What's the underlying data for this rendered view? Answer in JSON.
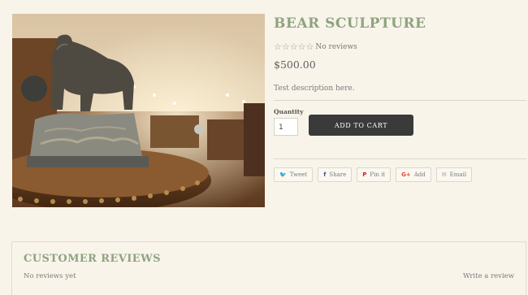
{
  "product": {
    "title": "BEAR SCULPTURE",
    "rating_stars": 5,
    "rating_text": "No reviews",
    "price": "$500.00",
    "description": "Test description here.",
    "image_alt": "Bronze bear sculpture on a wooden table in a gallery"
  },
  "purchase": {
    "quantity_label": "Quantity",
    "quantity_value": "1",
    "add_to_cart_label": "ADD TO CART"
  },
  "share": [
    {
      "label": "Tweet",
      "icon": "twitter-icon",
      "glyph": "🐦",
      "color": "#55acee"
    },
    {
      "label": "Share",
      "icon": "facebook-icon",
      "glyph": "f",
      "color": "#3b5998"
    },
    {
      "label": "Pin it",
      "icon": "pinterest-icon",
      "glyph": "P",
      "color": "#cb2027"
    },
    {
      "label": "Add",
      "icon": "google-plus-icon",
      "glyph": "G+",
      "color": "#dd4b39"
    },
    {
      "label": "Email",
      "icon": "email-icon",
      "glyph": "✉",
      "color": "#9a9a9a"
    }
  ],
  "reviews": {
    "title": "CUSTOMER REVIEWS",
    "empty_text": "No reviews yet",
    "write_review_label": "Write a review"
  },
  "colors": {
    "accent": "#8fa37f",
    "background": "#f8f4ea",
    "button": "#3a3a3a"
  }
}
